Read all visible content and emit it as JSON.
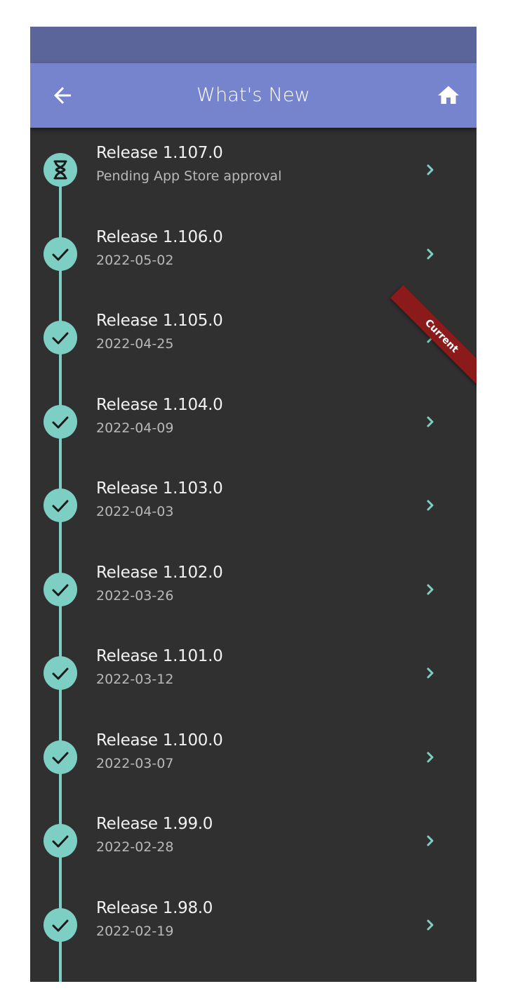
{
  "app_bar": {
    "title": "What's New",
    "back_icon": "arrow-left-icon",
    "home_icon": "home-icon"
  },
  "colors": {
    "status_bar": "#5c6599",
    "app_bar": "#7584cc",
    "background": "#303030",
    "timeline": "#7dcfc4",
    "ribbon": "#8b1a1a"
  },
  "ribbon": {
    "label": "Current"
  },
  "releases": [
    {
      "title": "Release 1.107.0",
      "subtitle": "Pending App Store approval",
      "status_icon": "hourglass-icon"
    },
    {
      "title": "Release 1.106.0",
      "subtitle": "2022-05-02",
      "status_icon": "check-icon"
    },
    {
      "title": "Release 1.105.0",
      "subtitle": "2022-04-25",
      "status_icon": "check-icon"
    },
    {
      "title": "Release 1.104.0",
      "subtitle": "2022-04-09",
      "status_icon": "check-icon"
    },
    {
      "title": "Release 1.103.0",
      "subtitle": "2022-04-03",
      "status_icon": "check-icon"
    },
    {
      "title": "Release 1.102.0",
      "subtitle": "2022-03-26",
      "status_icon": "check-icon"
    },
    {
      "title": "Release 1.101.0",
      "subtitle": "2022-03-12",
      "status_icon": "check-icon"
    },
    {
      "title": "Release 1.100.0",
      "subtitle": "2022-03-07",
      "status_icon": "check-icon"
    },
    {
      "title": "Release 1.99.0",
      "subtitle": "2022-02-28",
      "status_icon": "check-icon"
    },
    {
      "title": "Release 1.98.0",
      "subtitle": "2022-02-19",
      "status_icon": "check-icon"
    }
  ]
}
